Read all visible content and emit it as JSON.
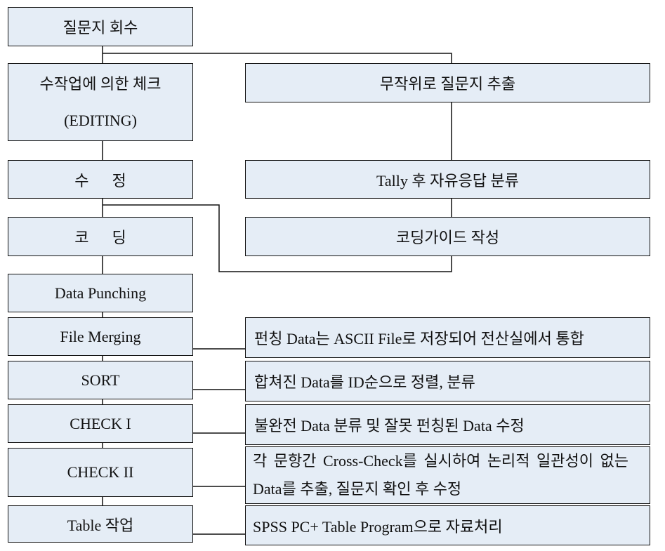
{
  "main_flow": [
    {
      "label": "질문지 회수"
    },
    {
      "label": "수작업에 의한 체크",
      "sub": "(EDITING)"
    },
    {
      "label": "수      정"
    },
    {
      "label": "코      딩"
    },
    {
      "label": "Data Punching"
    },
    {
      "label": "File Merging"
    },
    {
      "label": "SORT"
    },
    {
      "label": "CHECK I"
    },
    {
      "label": "CHECK II"
    },
    {
      "label": "Table 작업"
    }
  ],
  "side_flow": [
    {
      "label": "무작위로 질문지 추출"
    },
    {
      "label": "Tally 후 자유응답 분류"
    },
    {
      "label": "코딩가이드 작성"
    }
  ],
  "descriptions": [
    {
      "label": "펀칭 Data는 ASCII File로 저장되어 전산실에서 통합"
    },
    {
      "label": "합쳐진 Data를 ID순으로 정렬, 분류"
    },
    {
      "label": "불완전 Data 분류 및 잘못 펀칭된 Data 수정"
    },
    {
      "line1": "각 문항간 Cross-Check를 실시하여 논리적 일관성이 없는",
      "line2": "Data를 추출, 질문지 확인 후 수정"
    },
    {
      "label": "SPSS PC+ Table Program으로 자료처리"
    }
  ],
  "colors": {
    "box_fill": "#e5edf6",
    "line": "#111111"
  }
}
